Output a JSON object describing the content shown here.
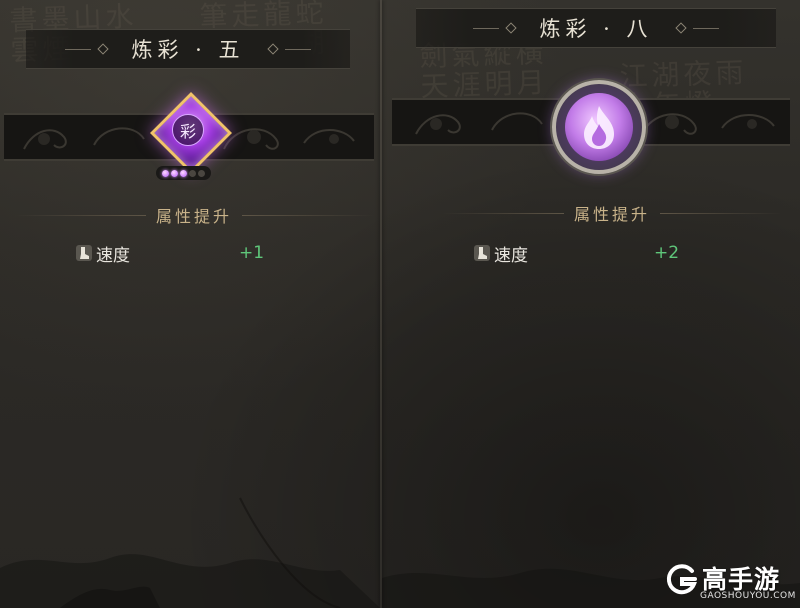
{
  "left_panel": {
    "title": "炼彩 · 五",
    "gem_char": "彩",
    "stars_filled": 3,
    "stars_total": 5,
    "section_title": "属性提升",
    "stat": {
      "name": "速度",
      "value": "+1",
      "icon": "boot-icon"
    }
  },
  "right_panel": {
    "title": "炼彩 · 八",
    "emblem_icon": "flame-orb-icon",
    "section_title": "属性提升",
    "stat": {
      "name": "速度",
      "value": "+2",
      "icon": "boot-icon"
    }
  },
  "watermark": {
    "name": "高手游",
    "domain": "GAOSHOUYOU.COM",
    "logo_icon": "g-logo-icon"
  },
  "colors": {
    "background": "#2d2b27",
    "title_text": "#e8e2d4",
    "section_text": "#c9b38a",
    "stat_text": "#e9e6df",
    "stat_value": "#5fc67a",
    "gem_purple": "#a23ce0",
    "gem_border": "#f1c36b"
  }
}
